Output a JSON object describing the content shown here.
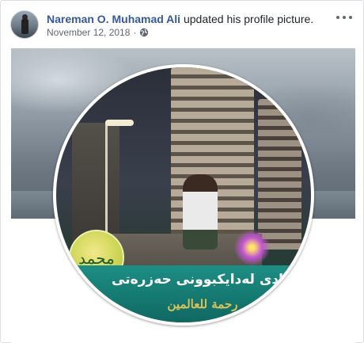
{
  "post": {
    "author_name": "Nareman O. Muhamad Ali",
    "action_text": " updated his profile picture.",
    "date": "November 12, 2018",
    "separator": "·",
    "privacy_icon": "globe-icon",
    "more_icon": "more-options-icon"
  },
  "photo": {
    "banner_line1": "بیت بادی لەدایکبوونی حەزرەتی",
    "banner_line2": "رحمة للعالمين",
    "emblem_text": "محمد"
  },
  "colors": {
    "name_link": "#365899",
    "meta_text": "#616770",
    "banner_teal": "#12726a"
  }
}
